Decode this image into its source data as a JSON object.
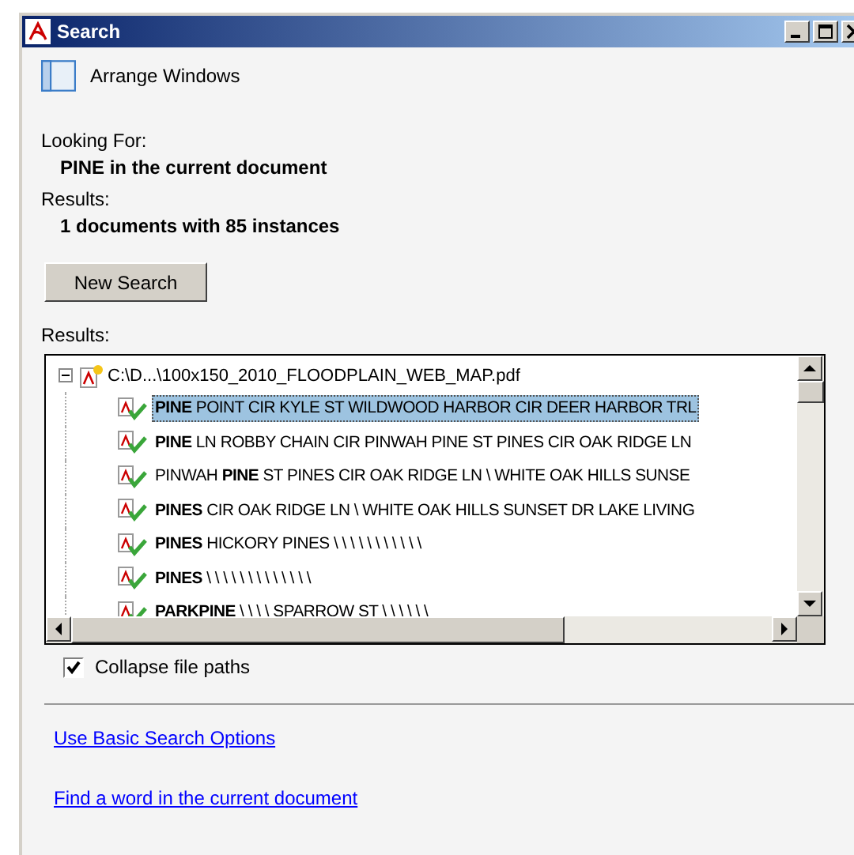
{
  "window": {
    "title": "Search"
  },
  "arrange_windows": {
    "label": "Arrange Windows"
  },
  "looking_for": {
    "label": "Looking For:",
    "value": "PINE in the current document"
  },
  "results_summary": {
    "label": "Results:",
    "value": "1 documents with 85 instances"
  },
  "new_search_button": "New Search",
  "results": {
    "label": "Results:",
    "tree": [
      {
        "label": "C:\\D...\\100x150_2010_FLOODPLAIN_WEB_MAP.pdf",
        "expanded": true,
        "children": [
          {
            "text": "**PINE** POINT CIR KYLE ST WILDWOOD HARBOR CIR DEER HARBOR TRL",
            "selected": true
          },
          {
            "text": "**PINE** LN ROBBY CHAIN CIR PINWAH PINE ST PINES CIR OAK RIDGE LN",
            "selected": false
          },
          {
            "text": "PINWAH **PINE** ST PINES CIR OAK RIDGE LN \\ WHITE OAK HILLS SUNSE",
            "selected": false
          },
          {
            "text": "**PINES** CIR OAK RIDGE LN \\ WHITE OAK HILLS SUNSET DR LAKE LIVING",
            "selected": false
          },
          {
            "text": "**PINES** HICKORY PINES \\ \\ \\ \\ \\ \\ \\ \\ \\ \\ \\",
            "selected": false
          },
          {
            "text": "**PINES** \\ \\ \\ \\ \\ \\ \\ \\ \\ \\ \\ \\ \\",
            "selected": false
          },
          {
            "text": "**PARKPINE** \\ \\ \\ \\ SPARROW ST \\ \\ \\ \\ \\ \\",
            "selected": false
          }
        ]
      }
    ]
  },
  "collapse_file_paths": {
    "label": "Collapse file paths",
    "checked": true
  },
  "links": [
    "Use Basic Search Options",
    "Find a word in the current document"
  ]
}
